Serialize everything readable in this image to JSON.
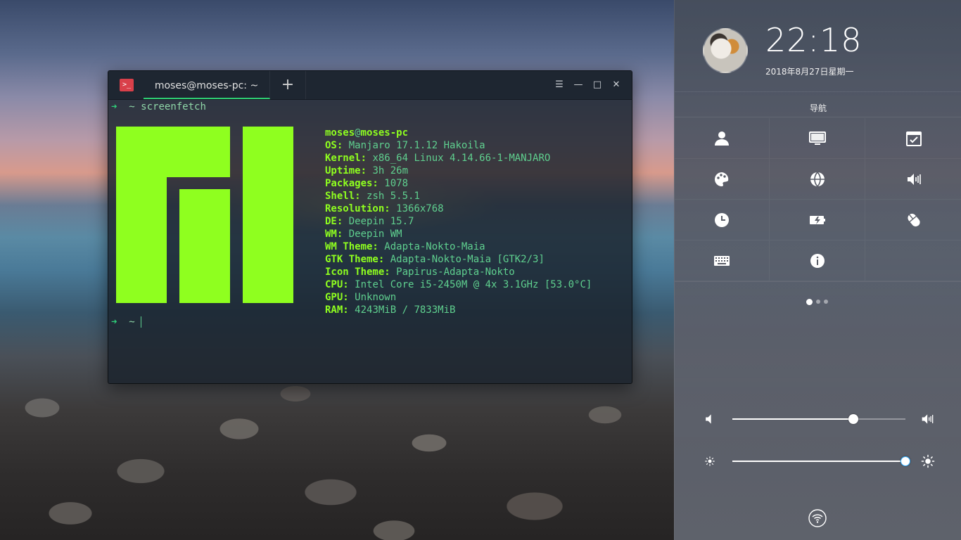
{
  "terminal": {
    "app_icon": ">_",
    "tab_title": "moses@moses-pc: ~",
    "tab_add": "+",
    "menu_icon": "☰",
    "minimize_icon": "—",
    "maximize_icon": "□",
    "close_icon": "✕",
    "prompt_arrow": "➜",
    "prompt_dir": "~",
    "command": "screenfetch",
    "userhost": {
      "user": "moses",
      "at": "@",
      "host": "moses-pc"
    },
    "info": [
      {
        "key": "OS:",
        "value": "Manjaro 17.1.12 Hakoila"
      },
      {
        "key": "Kernel:",
        "value": "x86_64 Linux 4.14.66-1-MANJARO"
      },
      {
        "key": "Uptime:",
        "value": "3h 26m"
      },
      {
        "key": "Packages:",
        "value": "1078"
      },
      {
        "key": "Shell:",
        "value": "zsh 5.5.1"
      },
      {
        "key": "Resolution:",
        "value": "1366x768"
      },
      {
        "key": "DE:",
        "value": "Deepin 15.7"
      },
      {
        "key": "WM:",
        "value": "Deepin WM"
      },
      {
        "key": "WM Theme:",
        "value": "Adapta-Nokto-Maia"
      },
      {
        "key": "GTK Theme:",
        "value": "Adapta-Nokto-Maia [GTK2/3]"
      },
      {
        "key": "Icon Theme:",
        "value": "Papirus-Adapta-Nokto"
      },
      {
        "key": "CPU:",
        "value": "Intel Core i5-2450M @ 4x 3.1GHz [53.0°C]"
      },
      {
        "key": "GPU:",
        "value": "Unknown"
      },
      {
        "key": "RAM:",
        "value": "4243MiB / 7833MiB"
      }
    ],
    "logo_color": "#8fff1f"
  },
  "panel": {
    "time": "22:18",
    "date": "2018年8月27日星期一",
    "nav_title": "导航",
    "grid_icons": [
      "user-icon",
      "display-icon",
      "calendar-check-icon",
      "palette-icon",
      "network-icon",
      "sound-icon",
      "clock-icon",
      "power-icon",
      "mouse-icon",
      "keyboard-icon",
      "info-icon"
    ],
    "page_dots": 3,
    "active_page": 1,
    "volume_level": 0.7,
    "brightness_level": 1.0,
    "accent_color": "#2ca7f8"
  }
}
